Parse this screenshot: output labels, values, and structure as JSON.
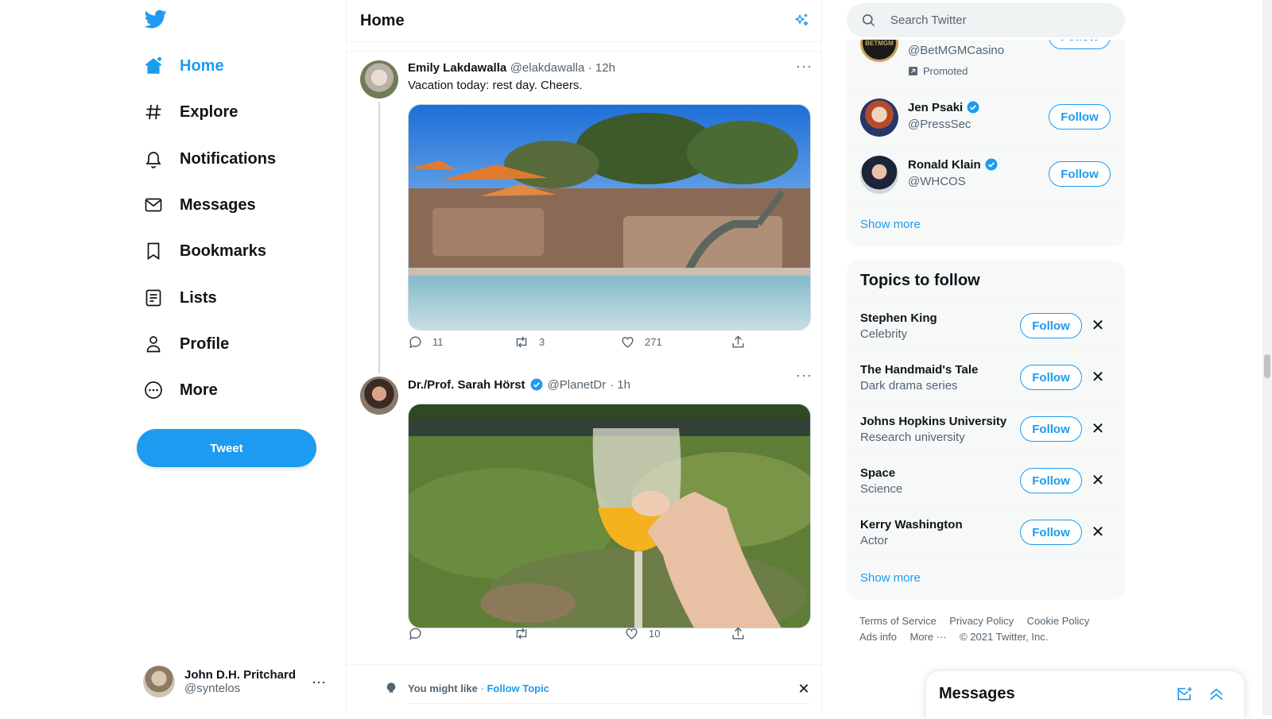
{
  "nav": {
    "items": [
      {
        "label": "Home",
        "icon": "home-icon"
      },
      {
        "label": "Explore",
        "icon": "hashtag-icon"
      },
      {
        "label": "Notifications",
        "icon": "bell-icon"
      },
      {
        "label": "Messages",
        "icon": "envelope-icon"
      },
      {
        "label": "Bookmarks",
        "icon": "bookmark-icon"
      },
      {
        "label": "Lists",
        "icon": "list-icon"
      },
      {
        "label": "Profile",
        "icon": "person-icon"
      },
      {
        "label": "More",
        "icon": "more-circle-icon"
      }
    ],
    "tweet_button": "Tweet"
  },
  "account": {
    "name": "John D.H. Pritchard",
    "handle": "@syntelos"
  },
  "header": {
    "title": "Home"
  },
  "tweets": [
    {
      "name": "Emily Lakdawalla",
      "handle": "@elakdawalla",
      "time": "· 12h",
      "text": "Vacation today: rest day. Cheers.",
      "replies": "11",
      "retweets": "3",
      "likes": "271",
      "image": "poolside photo with orange umbrellas"
    },
    {
      "name": "Dr./Prof. Sarah Hörst",
      "handle": "@PlanetDr",
      "time": "· 1h",
      "verified": true,
      "replies": "",
      "retweets": "",
      "likes": "10",
      "image": "hand holding a mimosa glass over grass"
    }
  ],
  "you_might_like": {
    "label": "You might like",
    "sep": "·",
    "link": "Follow Topic"
  },
  "search": {
    "placeholder": "Search Twitter"
  },
  "who_to_follow": {
    "promoted_account": {
      "handle": "@BetMGMCasino",
      "promoted": "Promoted",
      "button": "Follow"
    },
    "accounts": [
      {
        "name": "Jen Psaki",
        "handle": "@PressSec",
        "button": "Follow",
        "verified": true
      },
      {
        "name": "Ronald Klain",
        "handle": "@WHCOS",
        "button": "Follow",
        "verified": true
      }
    ],
    "show_more": "Show more"
  },
  "topics": {
    "title": "Topics to follow",
    "items": [
      {
        "name": "Stephen King",
        "category": "Celebrity",
        "button": "Follow"
      },
      {
        "name": "The Handmaid's Tale",
        "category": "Dark drama series",
        "button": "Follow"
      },
      {
        "name": "Johns Hopkins University",
        "category": "Research university",
        "button": "Follow"
      },
      {
        "name": "Space",
        "category": "Science",
        "button": "Follow"
      },
      {
        "name": "Kerry Washington",
        "category": "Actor",
        "button": "Follow"
      }
    ],
    "show_more": "Show more"
  },
  "footer": {
    "links": [
      "Terms of Service",
      "Privacy Policy",
      "Cookie Policy"
    ],
    "ads": "Ads info",
    "more": "More ···",
    "copyright": "© 2021 Twitter, Inc."
  },
  "messages_dock": {
    "title": "Messages"
  },
  "colors": {
    "accent": "#1d9bf0",
    "text": "#0f1419",
    "muted": "#536471",
    "panel": "#f7f9f9"
  }
}
